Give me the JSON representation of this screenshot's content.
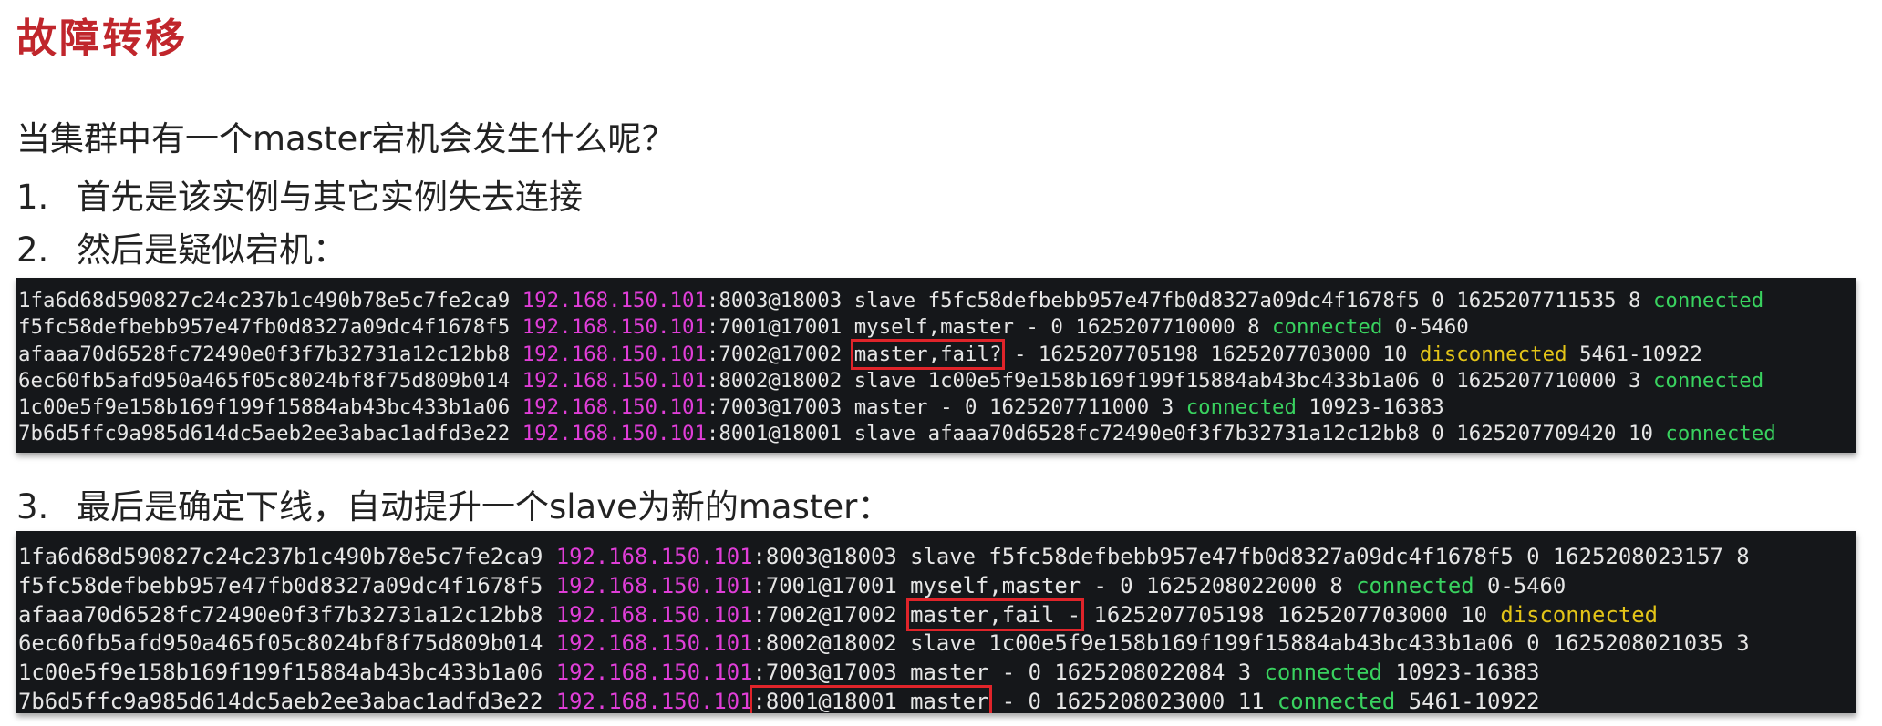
{
  "title": "故障转移",
  "question": "当集群中有一个master宕机会发生什么呢？",
  "steps": [
    {
      "num": "1.",
      "text": "首先是该实例与其它实例失去连接"
    },
    {
      "num": "2.",
      "text": "然后是疑似宕机："
    },
    {
      "num": "3.",
      "text": "最后是确定下线，自动提升一个slave为新的master："
    }
  ],
  "terminal1": [
    {
      "id": "1fa6d68d590827c24c237b1c490b78e5c7fe2ca9",
      "ip": "192.168.150.101",
      "port": ":8003@18003",
      "flags": "slave",
      "rest": " f5fc58defbebb957e47fb0d8327a09dc4f1678f5 0 1625207711535 8 ",
      "state": "connected",
      "tail": ""
    },
    {
      "id": "f5fc58defbebb957e47fb0d8327a09dc4f1678f5",
      "ip": "192.168.150.101",
      "port": ":7001@17001",
      "flags": "myself,master",
      "rest": " - 0 1625207710000 8 ",
      "state": "connected",
      "tail": " 0-5460"
    },
    {
      "id": "afaaa70d6528fc72490e0f3f7b32731a12c12bb8",
      "ip": "192.168.150.101",
      "port": ":7002@17002",
      "flags": "master,fail?",
      "rest": " - 1625207705198 1625207703000 10 ",
      "state": "disconnected",
      "tail": " 5461-10922"
    },
    {
      "id": "6ec60fb5afd950a465f05c8024bf8f75d809b014",
      "ip": "192.168.150.101",
      "port": ":8002@18002",
      "flags": "slave",
      "rest": " 1c00e5f9e158b169f199f15884ab43bc433b1a06 0 1625207710000 3 ",
      "state": "connected",
      "tail": ""
    },
    {
      "id": "1c00e5f9e158b169f199f15884ab43bc433b1a06",
      "ip": "192.168.150.101",
      "port": ":7003@17003",
      "flags": "master",
      "rest": " - 0 1625207711000 3 ",
      "state": "connected",
      "tail": " 10923-16383"
    },
    {
      "id": "7b6d5ffc9a985d614dc5aeb2ee3abac1adfd3e22",
      "ip": "192.168.150.101",
      "port": ":8001@18001",
      "flags": "slave",
      "rest": " afaaa70d6528fc72490e0f3f7b32731a12c12bb8 0 1625207709420 10 ",
      "state": "connected",
      "tail": ""
    }
  ],
  "terminal2": [
    {
      "id": "1fa6d68d590827c24c237b1c490b78e5c7fe2ca9",
      "ip": "192.168.150.101",
      "port": ":8003@18003",
      "flags": "slave",
      "rest": " f5fc58defbebb957e47fb0d8327a09dc4f1678f5 0 1625208023157 8",
      "state": "",
      "tail": ""
    },
    {
      "id": "f5fc58defbebb957e47fb0d8327a09dc4f1678f5",
      "ip": "192.168.150.101",
      "port": ":7001@17001",
      "flags": "myself,master",
      "rest": " - 0 1625208022000 8 ",
      "state": "connected",
      "tail": " 0-5460"
    },
    {
      "id": "afaaa70d6528fc72490e0f3f7b32731a12c12bb8",
      "ip": "192.168.150.101",
      "port": ":7002@17002",
      "flags": "master,fail -",
      "rest": " 1625207705198 1625207703000 10 ",
      "state": "disconnected",
      "tail": ""
    },
    {
      "id": "6ec60fb5afd950a465f05c8024bf8f75d809b014",
      "ip": "192.168.150.101",
      "port": ":8002@18002",
      "flags": "slave",
      "rest": " 1c00e5f9e158b169f199f15884ab43bc433b1a06 0 1625208021035 3",
      "state": "",
      "tail": ""
    },
    {
      "id": "1c00e5f9e158b169f199f15884ab43bc433b1a06",
      "ip": "192.168.150.101",
      "port": ":7003@17003",
      "flags": "master",
      "rest": " - 0 1625208022084 3 ",
      "state": "connected",
      "tail": " 10923-16383"
    },
    {
      "id": "7b6d5ffc9a985d614dc5aeb2ee3abac1adfd3e22",
      "ip": "192.168.150.101",
      "port": "",
      "hlport": ":8001@18001 master",
      "flags": "",
      "rest": " - 0 1625208023000 11 ",
      "state": "connected",
      "tail": " 5461-10922"
    }
  ]
}
